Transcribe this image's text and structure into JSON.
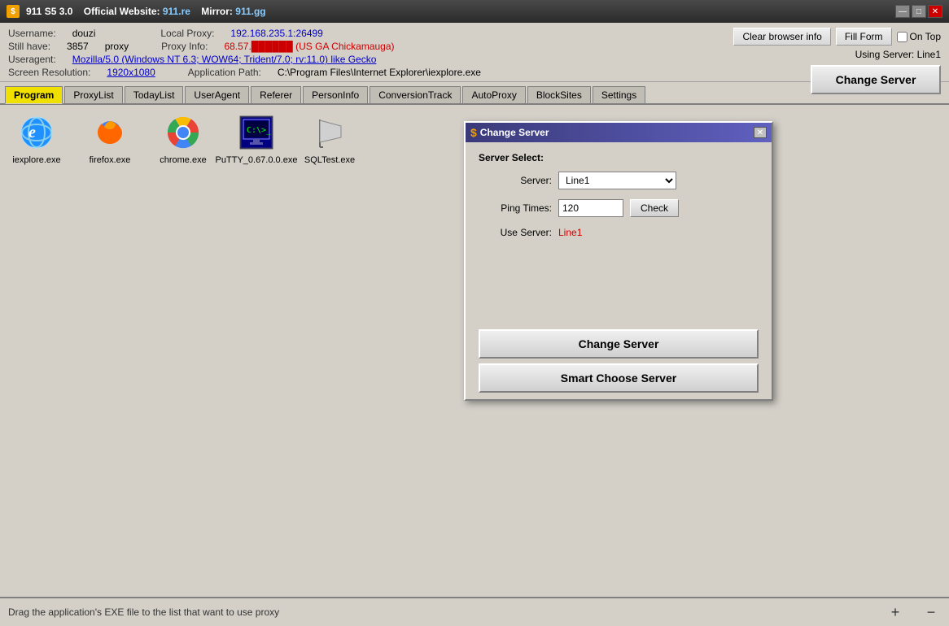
{
  "titlebar": {
    "icon": "$",
    "title": "911 S5 3.0",
    "website_label": "Official Website:",
    "website": "911.re",
    "mirror_label": "Mirror:",
    "mirror": "911.gg",
    "minimize": "—",
    "restore": "□",
    "close": "✕"
  },
  "info": {
    "username_label": "Username:",
    "username": "douzi",
    "local_proxy_label": "Local Proxy:",
    "local_proxy": "192.168.235.1:26499",
    "still_have_label": "Still have:",
    "still_have_count": "3857",
    "still_have_unit": "proxy",
    "proxy_info_label": "Proxy Info:",
    "proxy_info": "68.57.██████ (US GA Chickamauga)",
    "useragent_label": "Useragent:",
    "useragent": "Mozilla/5.0 (Windows NT 6.3; WOW64; Trident/7.0; rv:11.0) like Gecko",
    "screen_resolution_label": "Screen Resolution:",
    "screen_resolution": "1920x1080",
    "app_path_label": "Application Path:",
    "app_path": "C:\\Program Files\\Internet Explorer\\iexplore.exe"
  },
  "buttons": {
    "clear_browser_info": "Clear browser info",
    "fill_form": "Fill Form",
    "on_top_label": "On Top",
    "using_server_label": "Using Server:",
    "using_server_value": "Line1",
    "change_server": "Change Server"
  },
  "tabs": {
    "items": [
      {
        "id": "program",
        "label": "Program",
        "active": true
      },
      {
        "id": "proxylist",
        "label": "ProxyList",
        "active": false
      },
      {
        "id": "todaylist",
        "label": "TodayList",
        "active": false
      },
      {
        "id": "useragent",
        "label": "UserAgent",
        "active": false
      },
      {
        "id": "referer",
        "label": "Referer",
        "active": false
      },
      {
        "id": "personinfo",
        "label": "PersonInfo",
        "active": false
      },
      {
        "id": "conversiontrack",
        "label": "ConversionTrack",
        "active": false
      },
      {
        "id": "autoproxy",
        "label": "AutoProxy",
        "active": false
      },
      {
        "id": "blocksites",
        "label": "BlockSites",
        "active": false
      },
      {
        "id": "settings",
        "label": "Settings",
        "active": false
      }
    ]
  },
  "programs": [
    {
      "name": "iexplore.exe",
      "icon_type": "ie"
    },
    {
      "name": "firefox.exe",
      "icon_type": "ff"
    },
    {
      "name": "chrome.exe",
      "icon_type": "chrome"
    },
    {
      "name": "PuTTY_0.67.\n0.0.exe",
      "icon_type": "putty"
    },
    {
      "name": "SQLTest.exe",
      "icon_type": "sql"
    }
  ],
  "dialog": {
    "title": "Change Server",
    "section_label": "Server Select:",
    "server_label": "Server:",
    "server_value": "Line1",
    "ping_times_label": "Ping Times:",
    "ping_times_value": "120",
    "check_btn": "Check",
    "use_server_label": "Use Server:",
    "use_server_value": "Line1",
    "change_server_btn": "Change Server",
    "smart_choose_btn": "Smart Choose Server"
  },
  "statusbar": {
    "text": "Drag the application's EXE file to the list that want to use proxy",
    "add_btn": "+",
    "remove_btn": "−"
  }
}
